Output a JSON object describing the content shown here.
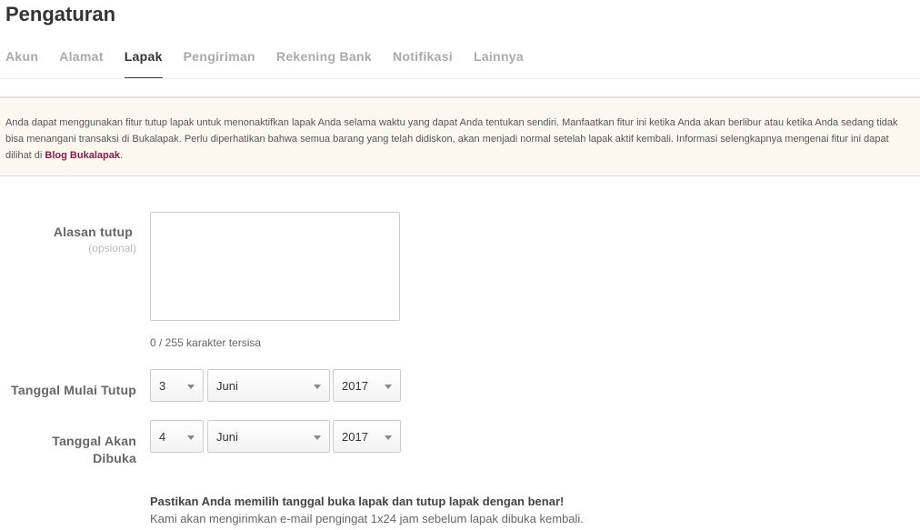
{
  "page": {
    "title": "Pengaturan"
  },
  "tabs": [
    {
      "label": "Akun"
    },
    {
      "label": "Alamat"
    },
    {
      "label": "Lapak",
      "active": true
    },
    {
      "label": "Pengiriman"
    },
    {
      "label": "Rekening Bank"
    },
    {
      "label": "Notifikasi"
    },
    {
      "label": "Lainnya"
    }
  ],
  "info": {
    "text": "Anda dapat menggunakan fitur tutup lapak untuk menonaktifkan lapak Anda selama waktu yang dapat Anda tentukan sendiri. Manfaatkan fitur ini ketika Anda akan berlibur atau ketika Anda sedang tidak bisa menangani transaksi di Bukalapak. Perlu diperhatikan bahwa semua barang yang telah didiskon, akan menjadi normal setelah lapak aktif kembali. Informasi selengkapnya mengenai fitur ini dapat dilihat di ",
    "link": "Blog Bukalapak",
    "end": "."
  },
  "form": {
    "reason_label": "Alasan tutup",
    "reason_optional": "(opsional)",
    "reason_value": "",
    "counter": "0 / 255 karakter tersisa",
    "start_label": "Tanggal Mulai Tutup",
    "start": {
      "day": "3",
      "month": "Juni",
      "year": "2017"
    },
    "open_label_1": "Tanggal Akan",
    "open_label_2": "Dibuka",
    "open": {
      "day": "4",
      "month": "Juni",
      "year": "2017"
    }
  },
  "notice": {
    "strong": "Pastikan Anda memilih tanggal buka lapak dan tutup lapak dengan benar!",
    "text": "Kami akan mengirimkan e-mail pengingat 1x24 jam sebelum lapak dibuka kembali."
  },
  "colors": {
    "accent": "#8b1a4a",
    "info_bg": "#fdf8ef"
  }
}
